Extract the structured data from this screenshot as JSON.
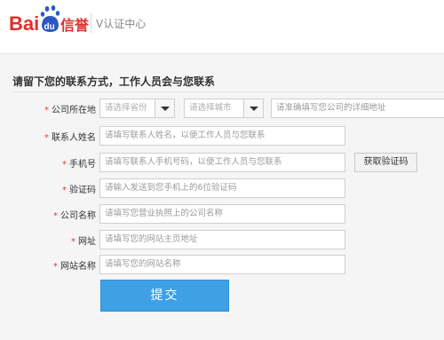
{
  "header": {
    "brand_word": "Bai",
    "brand_badge": "du",
    "brand_suffix": "信誉",
    "subtitle": "V认证中心"
  },
  "form": {
    "title": "请留下您的联系方式，工作人员会与您联系",
    "company_location": {
      "label": "公司所在地",
      "province_placeholder": "请选择省份",
      "city_placeholder": "请选择城市",
      "address_placeholder": "请准确填写您公司的详细地址"
    },
    "contact_name": {
      "label": "联系人姓名",
      "placeholder": "请填写联系人姓名，以便工作人员与您联系"
    },
    "phone": {
      "label": "手机号",
      "placeholder": "请填写联系人手机号码，以便工作人员与您联系",
      "button": "获取验证码"
    },
    "verify_code": {
      "label": "验证码",
      "placeholder": "请输入发送到您手机上的6位验证码"
    },
    "company_name": {
      "label": "公司名称",
      "placeholder": "请填写您营业执照上的公司名称"
    },
    "website": {
      "label": "网址",
      "placeholder": "请填写您的网站主页地址"
    },
    "site_name": {
      "label": "网站名称",
      "placeholder": "请填写您的网站名称"
    },
    "required_mark": "*",
    "submit": "提交"
  },
  "colors": {
    "brand_red": "#e02f2a",
    "brand_blue": "#2b59c3",
    "submit_blue": "#3fa0e6",
    "required_red": "#e4393c"
  }
}
